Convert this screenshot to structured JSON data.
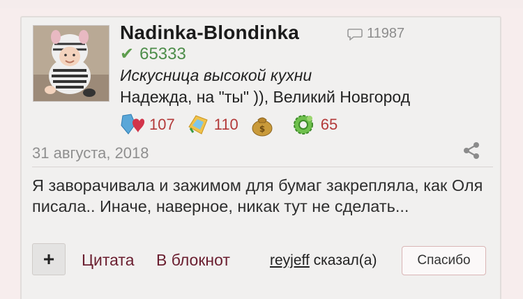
{
  "post": {
    "username": "Nadinka-Blondinka",
    "message_count": "11987",
    "rating": "65333",
    "status": "Искусница высокой кухни",
    "location": "Надежда, на \"ты\" )), Великий Новгород",
    "badges": [
      {
        "icon": "heart-crystal-icon",
        "value": "107"
      },
      {
        "icon": "notebook-badge-icon",
        "value": "110"
      },
      {
        "icon": "money-bag-icon",
        "value": ""
      },
      {
        "icon": "gear-cog-icon",
        "value": "65"
      }
    ],
    "date": "31 августа, 2018",
    "text": "Я заворачивала и зажимом для бумаг закрепляла, как Оля писала.. Иначе, наверное, никак тут не сделать...",
    "actions": {
      "plus_label": "+",
      "quote_label": "Цитата",
      "notebook_label": "В блокнот",
      "said_user": "reyjeff",
      "said_suffix": " сказал(а)",
      "thanks_label": "Спасибо"
    }
  },
  "colors": {
    "rating_green": "#4d8d4a",
    "badge_red": "#b33a3a",
    "link_maroon": "#6a1e2f"
  }
}
